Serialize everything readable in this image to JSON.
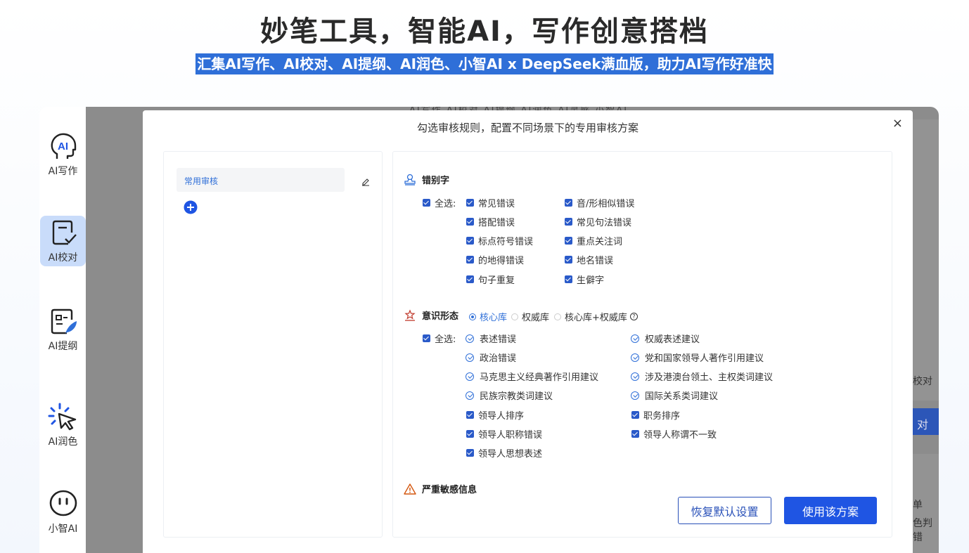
{
  "hero": {
    "title": "妙笔工具，智能AI，写作创意搭档",
    "subtitle": "汇集AI写作、AI校对、AI提纲、AI润色、小智AI x DeepSeek满血版，助力AI写作好准快"
  },
  "sidebar": {
    "items": [
      {
        "label": "AI写作",
        "icon": "ai-head-icon"
      },
      {
        "label": "AI校对",
        "icon": "proofread-icon",
        "active": true
      },
      {
        "label": "AI提纲",
        "icon": "outline-icon"
      },
      {
        "label": "AI润色",
        "icon": "polish-icon"
      },
      {
        "label": "小智AI",
        "icon": "chatbot-icon"
      }
    ]
  },
  "background": {
    "tabs": "AI写作  AI校对  AI提纲  AI润色  AI灵感  小智AI",
    "right_text_1": "校对",
    "right_btn": "对",
    "right_text_2": "单",
    "right_text_3": "色判错"
  },
  "modal": {
    "title": "勾选审核规则，配置不同场景下的专用审核方案",
    "close": "×",
    "presets": [
      "常用审核"
    ],
    "sections": {
      "typo": {
        "title": "错别字",
        "select_all": "全选:",
        "col1": [
          "常见错误",
          "搭配错误",
          "标点符号错误",
          "的地得错误",
          "句子重复"
        ],
        "col2": [
          "音/形相似错误",
          "常见句法错误",
          "重点关注词",
          "地名错误",
          "生僻字"
        ]
      },
      "ideology": {
        "title": "意识形态",
        "radios": [
          "核心库",
          "权威库",
          "核心库+权威库"
        ],
        "selected_radio": "核心库",
        "help": "?",
        "select_all": "全选:",
        "col1_suggest": [
          "表述错误",
          "政治错误",
          "马克思主义经典著作引用建议",
          "民族宗教类词建议"
        ],
        "col2_suggest": [
          "权威表述建议",
          "党和国家领导人著作引用建议",
          "涉及港澳台领土、主权类词建议",
          "国际关系类词建议"
        ],
        "col1_check": [
          "领导人排序",
          "领导人职称错误",
          "领导人思想表述"
        ],
        "col2_check": [
          "职务排序",
          "领导人称谓不一致"
        ]
      },
      "sensitive": {
        "title": "严重敏感信息"
      }
    },
    "buttons": {
      "reset": "恢复默认设置",
      "apply": "使用该方案"
    }
  },
  "colors": {
    "accent": "#1f55e3",
    "highlight": "#2f6fd8",
    "active_side": "#c9dcfa"
  }
}
